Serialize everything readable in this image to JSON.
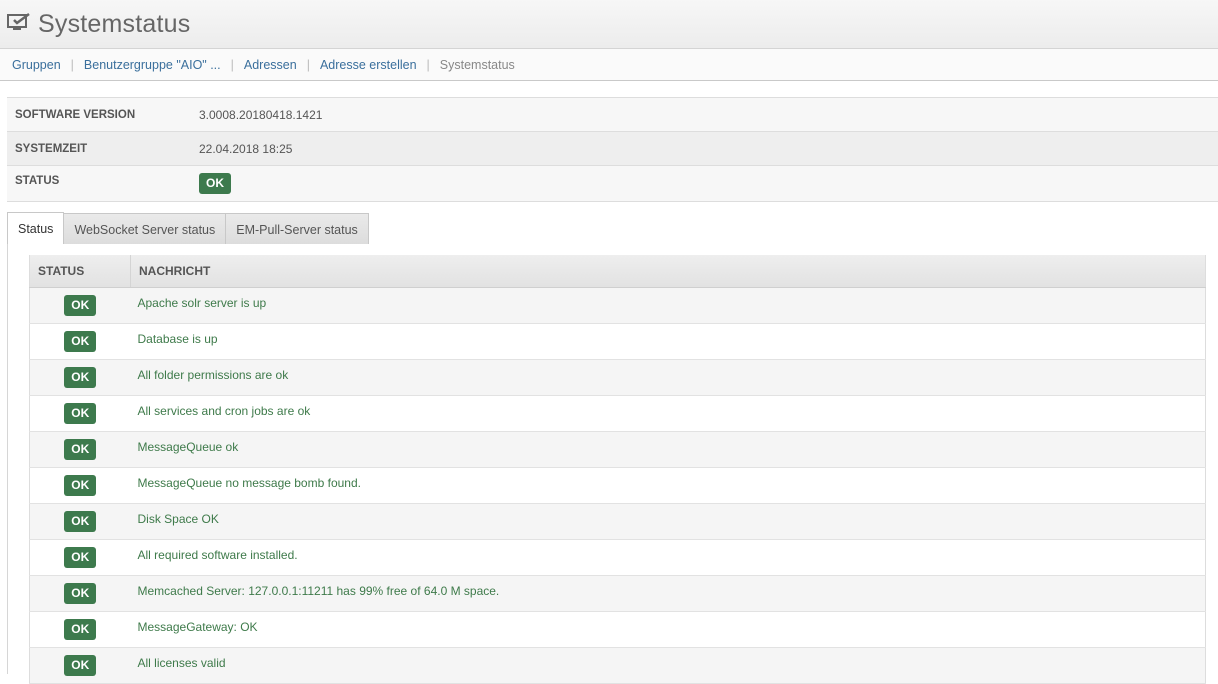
{
  "header": {
    "title": "Systemstatus",
    "icon": "monitor-check-icon"
  },
  "breadcrumb": {
    "items": [
      "Gruppen",
      "Benutzergruppe \"AIO\" ...",
      "Adressen",
      "Adresse erstellen"
    ],
    "current": "Systemstatus"
  },
  "info": {
    "software_label": "SOFTWARE VERSION",
    "software_value": "3.0008.20180418.1421",
    "time_label": "SYSTEMZEIT",
    "time_value": "22.04.2018 18:25",
    "status_label": "STATUS",
    "status_value": "OK"
  },
  "tabs": [
    "Status",
    "WebSocket Server status",
    "EM-Pull-Server status"
  ],
  "status_table": {
    "columns": [
      "STATUS",
      "NACHRICHT"
    ],
    "rows": [
      {
        "status": "OK",
        "message": "Apache solr server is up"
      },
      {
        "status": "OK",
        "message": "Database is up"
      },
      {
        "status": "OK",
        "message": "All folder permissions are ok"
      },
      {
        "status": "OK",
        "message": "All services and cron jobs are ok"
      },
      {
        "status": "OK",
        "message": "MessageQueue ok"
      },
      {
        "status": "OK",
        "message": "MessageQueue no message bomb found."
      },
      {
        "status": "OK",
        "message": "Disk Space OK"
      },
      {
        "status": "OK",
        "message": "All required software installed."
      },
      {
        "status": "OK",
        "message": "Memcached Server: 127.0.0.1:11211 has 99% free of 64.0 M space."
      },
      {
        "status": "OK",
        "message": "MessageGateway: OK"
      },
      {
        "status": "OK",
        "message": "All licenses valid"
      }
    ]
  },
  "colors": {
    "ok_badge": "#3d7a4d",
    "message_text": "#3e7a4a",
    "link": "#3a6f9c"
  }
}
